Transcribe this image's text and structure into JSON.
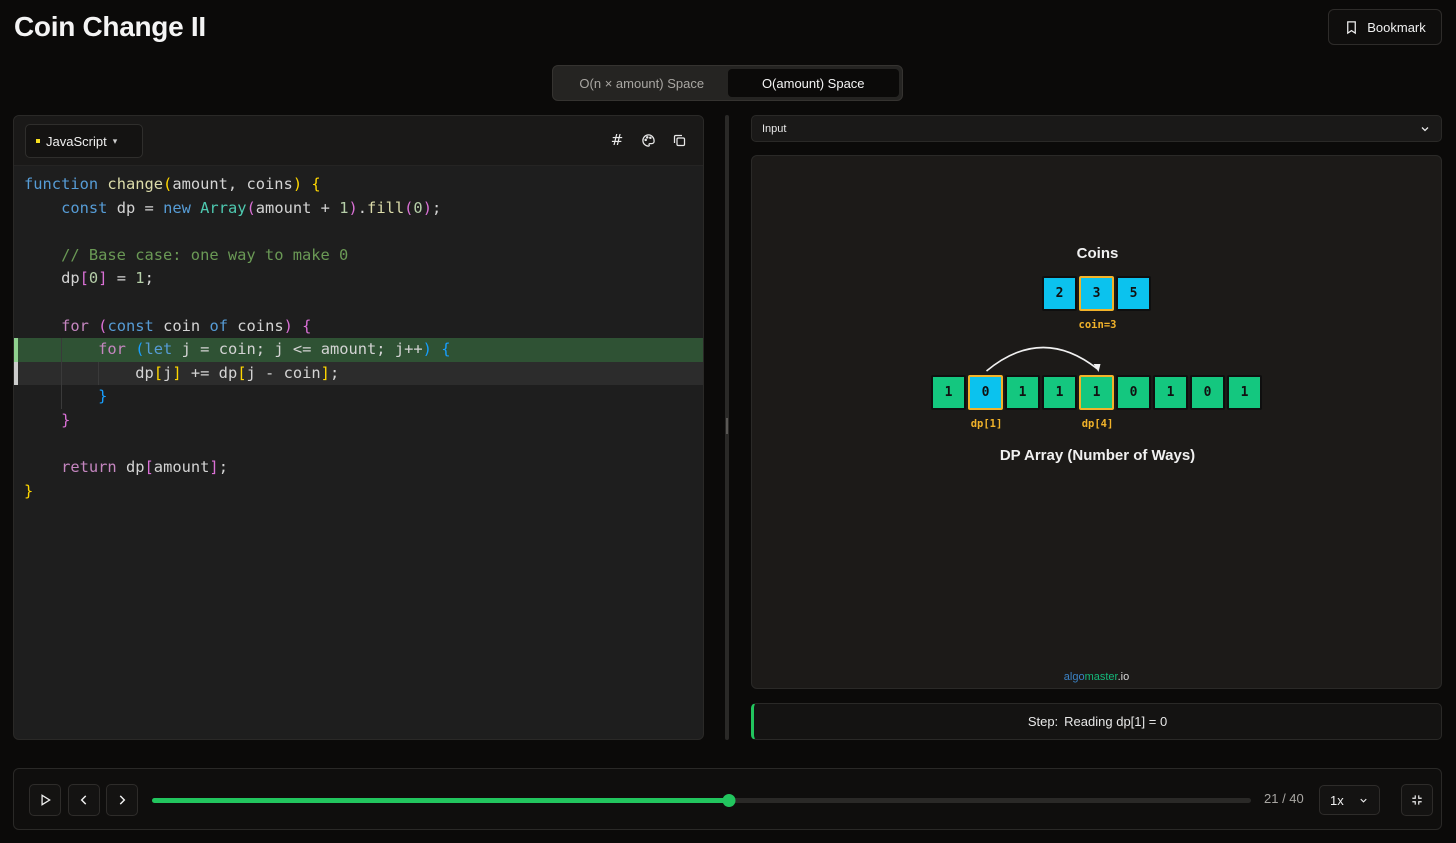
{
  "page": {
    "title": "Coin Change II",
    "bookmark_label": "Bookmark"
  },
  "approach_tabs": [
    {
      "label": "O(n × amount) Space",
      "active": false
    },
    {
      "label": "O(amount) Space",
      "active": true
    }
  ],
  "editor": {
    "language": "JavaScript",
    "icons": [
      "hash-icon",
      "palette-icon",
      "copy-icon"
    ],
    "active_line": 8,
    "next_line": 9,
    "lines": [
      "function change(amount, coins) {",
      "    const dp = new Array(amount + 1).fill(0);",
      "",
      "    // Base case: one way to make 0",
      "    dp[0] = 1;",
      "",
      "    for (const coin of coins) {",
      "        for (let j = coin; j <= amount; j++) {",
      "            dp[j] += dp[j - coin];",
      "        }",
      "    }",
      "",
      "    return dp[amount];",
      "}"
    ]
  },
  "input_panel": {
    "label": "Input"
  },
  "visualization": {
    "coins_label": "Coins",
    "coins": [
      2,
      3,
      5
    ],
    "current_coin_index": 1,
    "current_coin_label": "coin=3",
    "dp_values": [
      1,
      0,
      1,
      1,
      1,
      0,
      1,
      0,
      1
    ],
    "dp_read_index": 1,
    "dp_write_index": 4,
    "dp_read_label": "dp[1]",
    "dp_write_label": "dp[4]",
    "dp_label": "DP Array (Number of Ways)",
    "brand": {
      "part1": "algo",
      "part2": "master",
      "part3": ".io"
    },
    "colors": {
      "cyan": "#0bc2ee",
      "green": "#14c77f",
      "highlight": "#f2b32a"
    }
  },
  "step": {
    "prefix": "Step:",
    "text": "Reading dp[1] = 0"
  },
  "player": {
    "current": 21,
    "total": 40,
    "counter_text": "21 / 40",
    "speed": "1x",
    "progress": 0.525
  }
}
